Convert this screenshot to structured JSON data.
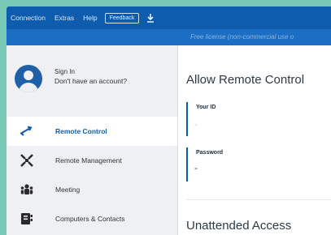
{
  "menubar": {
    "items": [
      "Connection",
      "Extras",
      "Help"
    ],
    "feedback_label": "Feedback",
    "download_icon": "download-icon"
  },
  "license_bar": {
    "text": "Free license (non-commercial use o"
  },
  "account": {
    "sign_in": "Sign In",
    "no_account": "Don't have an account?"
  },
  "sidebar": {
    "items": [
      {
        "label": "Remote Control",
        "icon": "arrows-icon",
        "active": true
      },
      {
        "label": "Remote Management",
        "icon": "management-icon",
        "active": false
      },
      {
        "label": "Meeting",
        "icon": "meeting-icon",
        "active": false
      },
      {
        "label": "Computers & Contacts",
        "icon": "contacts-icon",
        "active": false
      }
    ]
  },
  "main": {
    "title": "Allow Remote Control",
    "your_id_label": "Your ID",
    "your_id_value": "-",
    "password_label": "Password",
    "password_value": "-",
    "unattended_title": "Unattended Access"
  },
  "colors": {
    "menubar": "#0e5cae",
    "license_bar": "#1b6ec3",
    "accent": "#0e5cae",
    "background": "#78c9b5"
  }
}
